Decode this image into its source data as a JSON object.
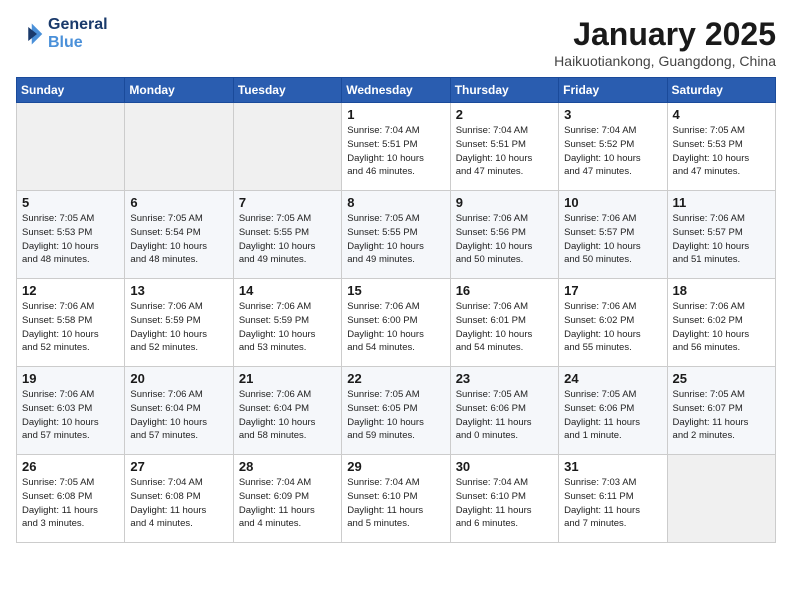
{
  "header": {
    "logo_line1": "General",
    "logo_line2": "Blue",
    "month_title": "January 2025",
    "subtitle": "Haikuotiankong, Guangdong, China"
  },
  "weekdays": [
    "Sunday",
    "Monday",
    "Tuesday",
    "Wednesday",
    "Thursday",
    "Friday",
    "Saturday"
  ],
  "weeks": [
    [
      {
        "day": "",
        "info": ""
      },
      {
        "day": "",
        "info": ""
      },
      {
        "day": "",
        "info": ""
      },
      {
        "day": "1",
        "info": "Sunrise: 7:04 AM\nSunset: 5:51 PM\nDaylight: 10 hours\nand 46 minutes."
      },
      {
        "day": "2",
        "info": "Sunrise: 7:04 AM\nSunset: 5:51 PM\nDaylight: 10 hours\nand 47 minutes."
      },
      {
        "day": "3",
        "info": "Sunrise: 7:04 AM\nSunset: 5:52 PM\nDaylight: 10 hours\nand 47 minutes."
      },
      {
        "day": "4",
        "info": "Sunrise: 7:05 AM\nSunset: 5:53 PM\nDaylight: 10 hours\nand 47 minutes."
      }
    ],
    [
      {
        "day": "5",
        "info": "Sunrise: 7:05 AM\nSunset: 5:53 PM\nDaylight: 10 hours\nand 48 minutes."
      },
      {
        "day": "6",
        "info": "Sunrise: 7:05 AM\nSunset: 5:54 PM\nDaylight: 10 hours\nand 48 minutes."
      },
      {
        "day": "7",
        "info": "Sunrise: 7:05 AM\nSunset: 5:55 PM\nDaylight: 10 hours\nand 49 minutes."
      },
      {
        "day": "8",
        "info": "Sunrise: 7:05 AM\nSunset: 5:55 PM\nDaylight: 10 hours\nand 49 minutes."
      },
      {
        "day": "9",
        "info": "Sunrise: 7:06 AM\nSunset: 5:56 PM\nDaylight: 10 hours\nand 50 minutes."
      },
      {
        "day": "10",
        "info": "Sunrise: 7:06 AM\nSunset: 5:57 PM\nDaylight: 10 hours\nand 50 minutes."
      },
      {
        "day": "11",
        "info": "Sunrise: 7:06 AM\nSunset: 5:57 PM\nDaylight: 10 hours\nand 51 minutes."
      }
    ],
    [
      {
        "day": "12",
        "info": "Sunrise: 7:06 AM\nSunset: 5:58 PM\nDaylight: 10 hours\nand 52 minutes."
      },
      {
        "day": "13",
        "info": "Sunrise: 7:06 AM\nSunset: 5:59 PM\nDaylight: 10 hours\nand 52 minutes."
      },
      {
        "day": "14",
        "info": "Sunrise: 7:06 AM\nSunset: 5:59 PM\nDaylight: 10 hours\nand 53 minutes."
      },
      {
        "day": "15",
        "info": "Sunrise: 7:06 AM\nSunset: 6:00 PM\nDaylight: 10 hours\nand 54 minutes."
      },
      {
        "day": "16",
        "info": "Sunrise: 7:06 AM\nSunset: 6:01 PM\nDaylight: 10 hours\nand 54 minutes."
      },
      {
        "day": "17",
        "info": "Sunrise: 7:06 AM\nSunset: 6:02 PM\nDaylight: 10 hours\nand 55 minutes."
      },
      {
        "day": "18",
        "info": "Sunrise: 7:06 AM\nSunset: 6:02 PM\nDaylight: 10 hours\nand 56 minutes."
      }
    ],
    [
      {
        "day": "19",
        "info": "Sunrise: 7:06 AM\nSunset: 6:03 PM\nDaylight: 10 hours\nand 57 minutes."
      },
      {
        "day": "20",
        "info": "Sunrise: 7:06 AM\nSunset: 6:04 PM\nDaylight: 10 hours\nand 57 minutes."
      },
      {
        "day": "21",
        "info": "Sunrise: 7:06 AM\nSunset: 6:04 PM\nDaylight: 10 hours\nand 58 minutes."
      },
      {
        "day": "22",
        "info": "Sunrise: 7:05 AM\nSunset: 6:05 PM\nDaylight: 10 hours\nand 59 minutes."
      },
      {
        "day": "23",
        "info": "Sunrise: 7:05 AM\nSunset: 6:06 PM\nDaylight: 11 hours\nand 0 minutes."
      },
      {
        "day": "24",
        "info": "Sunrise: 7:05 AM\nSunset: 6:06 PM\nDaylight: 11 hours\nand 1 minute."
      },
      {
        "day": "25",
        "info": "Sunrise: 7:05 AM\nSunset: 6:07 PM\nDaylight: 11 hours\nand 2 minutes."
      }
    ],
    [
      {
        "day": "26",
        "info": "Sunrise: 7:05 AM\nSunset: 6:08 PM\nDaylight: 11 hours\nand 3 minutes."
      },
      {
        "day": "27",
        "info": "Sunrise: 7:04 AM\nSunset: 6:08 PM\nDaylight: 11 hours\nand 4 minutes."
      },
      {
        "day": "28",
        "info": "Sunrise: 7:04 AM\nSunset: 6:09 PM\nDaylight: 11 hours\nand 4 minutes."
      },
      {
        "day": "29",
        "info": "Sunrise: 7:04 AM\nSunset: 6:10 PM\nDaylight: 11 hours\nand 5 minutes."
      },
      {
        "day": "30",
        "info": "Sunrise: 7:04 AM\nSunset: 6:10 PM\nDaylight: 11 hours\nand 6 minutes."
      },
      {
        "day": "31",
        "info": "Sunrise: 7:03 AM\nSunset: 6:11 PM\nDaylight: 11 hours\nand 7 minutes."
      },
      {
        "day": "",
        "info": ""
      }
    ]
  ]
}
